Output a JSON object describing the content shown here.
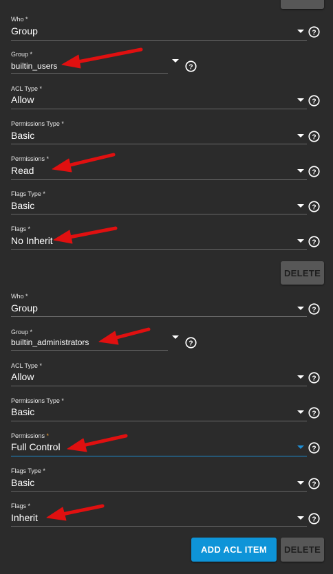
{
  "required_mark": "*",
  "entries": [
    {
      "who": {
        "label": "Who",
        "value": "Group"
      },
      "group": {
        "label": "Group",
        "value": "builtin_users"
      },
      "acl_type": {
        "label": "ACL Type",
        "value": "Allow"
      },
      "perm_type": {
        "label": "Permissions Type",
        "value": "Basic"
      },
      "permissions": {
        "label": "Permissions",
        "value": "Read"
      },
      "flags_type": {
        "label": "Flags Type",
        "value": "Basic"
      },
      "flags": {
        "label": "Flags",
        "value": "No Inherit"
      },
      "delete_label": "DELETE"
    },
    {
      "who": {
        "label": "Who",
        "value": "Group"
      },
      "group": {
        "label": "Group",
        "value": "builtin_administrators"
      },
      "acl_type": {
        "label": "ACL Type",
        "value": "Allow"
      },
      "perm_type": {
        "label": "Permissions Type",
        "value": "Basic"
      },
      "permissions": {
        "label": "Permissions",
        "value": "Full Control"
      },
      "flags_type": {
        "label": "Flags Type",
        "value": "Basic"
      },
      "flags": {
        "label": "Flags",
        "value": "Inherit"
      },
      "delete_label": "DELETE"
    }
  ],
  "footer": {
    "add_label": "ADD ACL ITEM",
    "delete_label": "DELETE"
  },
  "colors": {
    "accent": "#0e94d8",
    "focus_underline": "#1e8fd6",
    "required_focus": "#f0a23a",
    "annotation_arrow": "#e01010"
  }
}
